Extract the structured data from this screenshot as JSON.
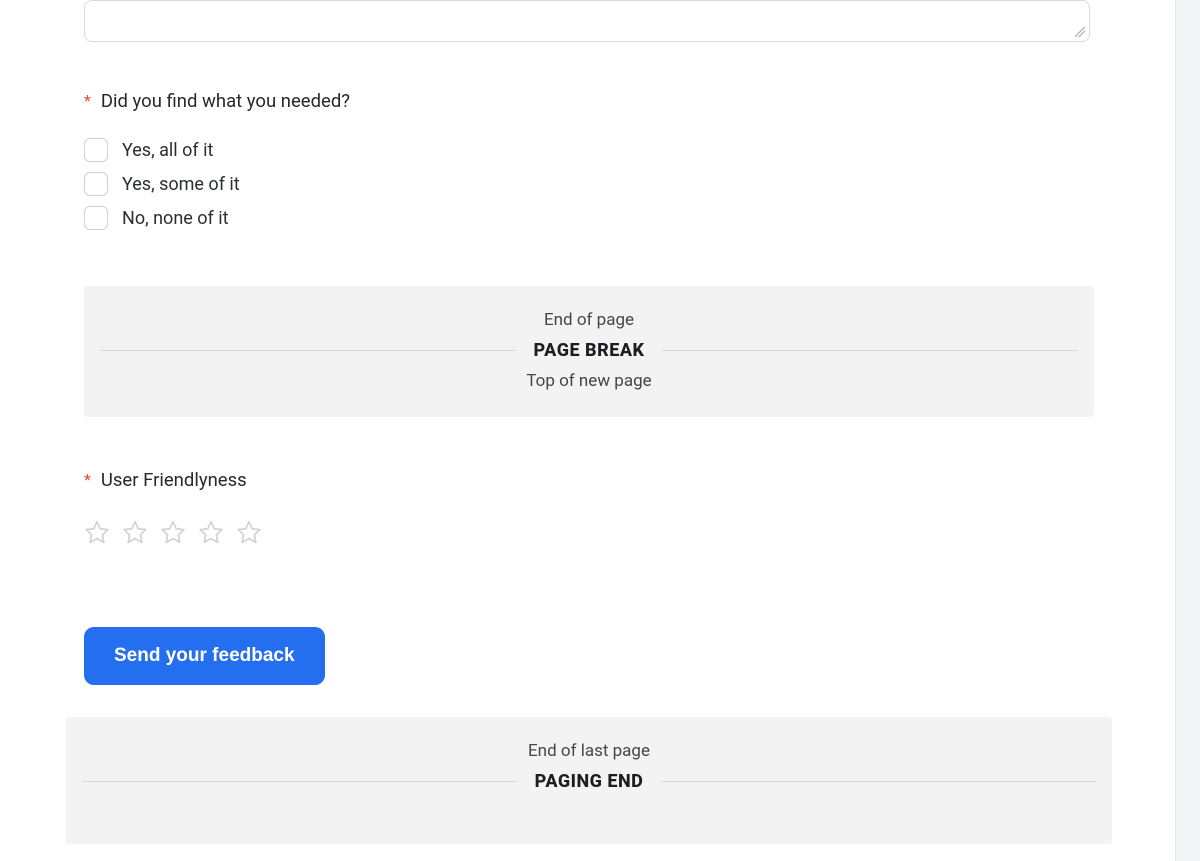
{
  "question_needed": {
    "label": "Did you find what you needed?",
    "required_marker": "*",
    "options": [
      "Yes, all of it",
      "Yes, some of it",
      "No, none of it"
    ]
  },
  "page_break": {
    "end_label": "End of page",
    "title": "PAGE BREAK",
    "top_label": "Top of new page"
  },
  "question_friendliness": {
    "label": "User Friendlyness",
    "required_marker": "*",
    "star_count": 5
  },
  "submit": {
    "label": "Send your feedback"
  },
  "paging_end": {
    "end_label": "End of last page",
    "title": "PAGING END"
  },
  "colors": {
    "primary": "#246ef0",
    "required": "#e04c3c"
  }
}
